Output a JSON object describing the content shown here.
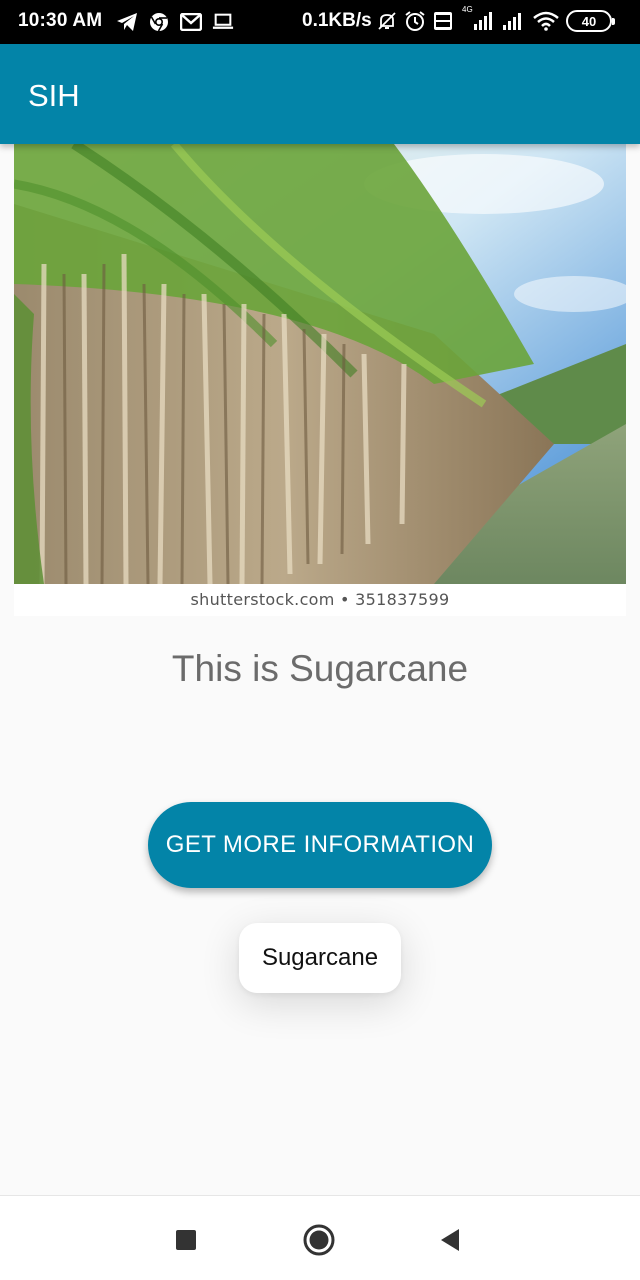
{
  "status_bar": {
    "time": "10:30 AM",
    "speed": "0.1KB/s",
    "battery": "40",
    "left_icons": [
      "telegram-icon",
      "chrome-icon",
      "gmail-icon",
      "laptop-icon"
    ],
    "right_icons": [
      "mute-icon",
      "alarm-icon",
      "volte-icon",
      "signal-4g-icon",
      "signal-icon",
      "wifi-icon"
    ],
    "network_type": "4G"
  },
  "app_bar": {
    "title": "SIH",
    "color": "#0384a8"
  },
  "hero": {
    "image_subject": "sugarcane field",
    "caption": "shutterstock.com • 351837599"
  },
  "main": {
    "title": "This is Sugarcane",
    "button_label": "GET MORE INFORMATION"
  },
  "toast": {
    "text": "Sugarcane"
  },
  "nav_bar": {
    "icons": [
      "recents-square-icon",
      "home-circle-icon",
      "back-triangle-icon"
    ]
  }
}
